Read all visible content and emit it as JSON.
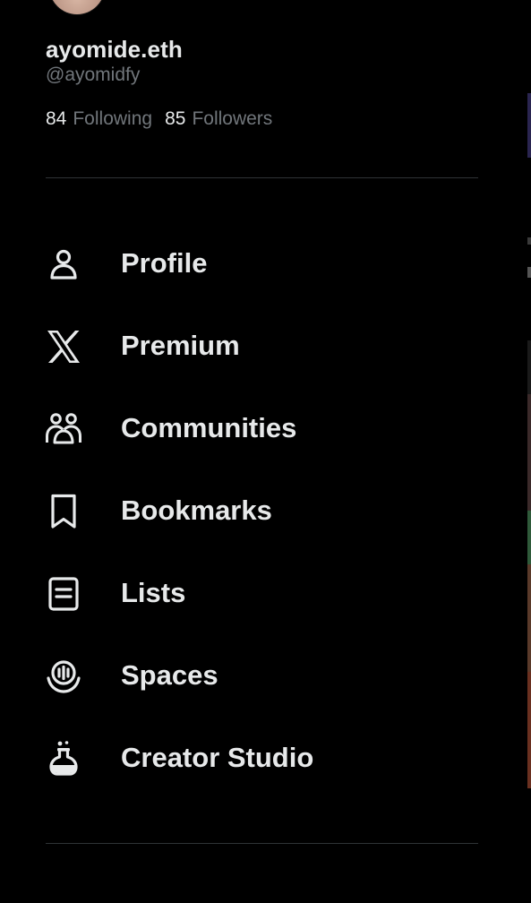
{
  "profile": {
    "display_name": "ayomide.eth",
    "handle": "@ayomidfy",
    "following_count": "84",
    "following_label": "Following",
    "followers_count": "85",
    "followers_label": "Followers"
  },
  "menu": {
    "items": [
      {
        "label": "Profile",
        "icon": "person-icon"
      },
      {
        "label": "Premium",
        "icon": "x-logo-icon"
      },
      {
        "label": "Communities",
        "icon": "communities-icon"
      },
      {
        "label": "Bookmarks",
        "icon": "bookmark-icon"
      },
      {
        "label": "Lists",
        "icon": "list-icon"
      },
      {
        "label": "Spaces",
        "icon": "spaces-icon"
      },
      {
        "label": "Creator Studio",
        "icon": "flask-icon"
      }
    ]
  },
  "colors": {
    "background": "#000000",
    "primary_text": "#e7e9ea",
    "secondary_text": "#71767b",
    "divider": "#2f3336"
  }
}
